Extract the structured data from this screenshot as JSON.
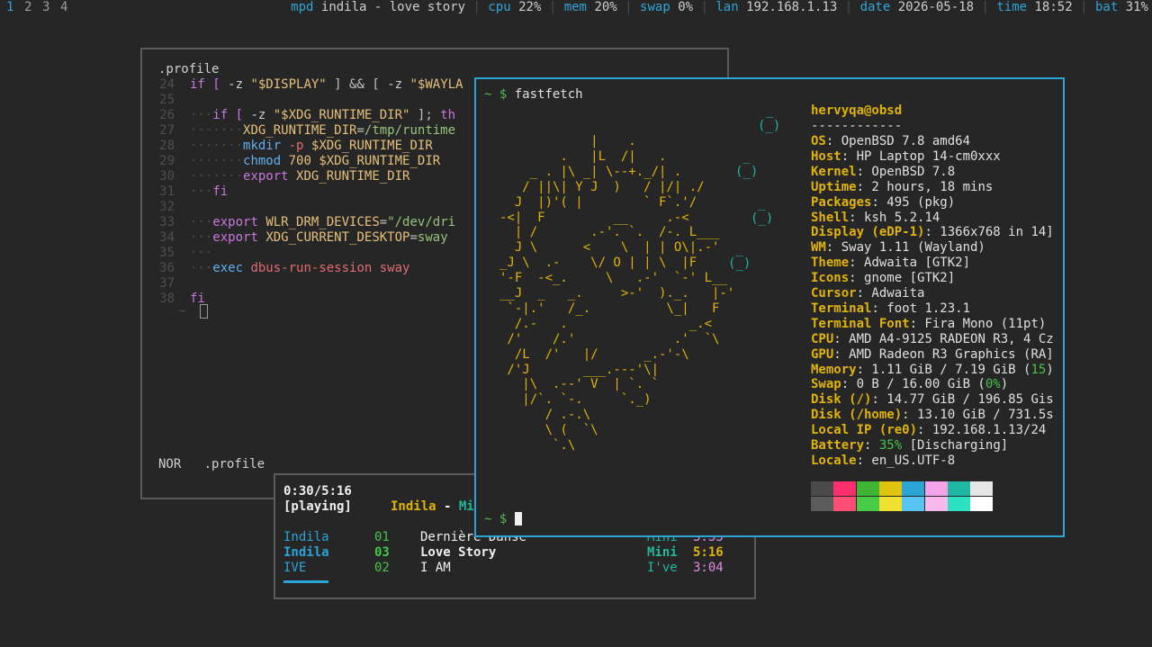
{
  "bar": {
    "workspaces": [
      "1",
      "2",
      "3",
      "4"
    ],
    "mpd_label": "mpd",
    "mpd_value": "indila - love story",
    "cpu_label": "cpu",
    "cpu_value": "22%",
    "mem_label": "mem",
    "mem_value": "20%",
    "swap_label": "swap",
    "swap_value": "0%",
    "lan_label": "lan",
    "lan_value": "192.168.1.13",
    "date_label": "date",
    "date_value": "2026-05-18",
    "time_label": "time",
    "time_value": "18:52",
    "bat_label": "bat",
    "bat_value": "31%",
    "separator": "|"
  },
  "editor": {
    "filename_top": ".profile",
    "mode": "NOR",
    "filename_status": ".profile",
    "tilde": "~",
    "lines": [
      {
        "n": "24",
        "indent": "",
        "tokens": [
          {
            "t": "if [ ",
            "c": "kw"
          },
          {
            "t": "-z ",
            "c": "pl"
          },
          {
            "t": "\"$DISPLAY\"",
            "c": "var"
          },
          {
            "t": " ] && [ ",
            "c": "pun"
          },
          {
            "t": "-z ",
            "c": "pl"
          },
          {
            "t": "\"$WAYLA",
            "c": "var"
          }
        ]
      },
      {
        "n": "25",
        "indent": "",
        "tokens": []
      },
      {
        "n": "26",
        "indent": "···",
        "tokens": [
          {
            "t": "if [ ",
            "c": "kw"
          },
          {
            "t": "-z ",
            "c": "pl"
          },
          {
            "t": "\"$XDG_RUNTIME_DIR\"",
            "c": "var"
          },
          {
            "t": " ]; ",
            "c": "pun"
          },
          {
            "t": "th",
            "c": "kw"
          }
        ]
      },
      {
        "n": "27",
        "indent": "·······",
        "tokens": [
          {
            "t": "XDG_RUNTIME_DIR",
            "c": "var"
          },
          {
            "t": "=",
            "c": "pun"
          },
          {
            "t": "/tmp/runtime",
            "c": "str"
          }
        ]
      },
      {
        "n": "28",
        "indent": "·······",
        "tokens": [
          {
            "t": "mkdir ",
            "c": "cmd"
          },
          {
            "t": "-p ",
            "c": "red"
          },
          {
            "t": "$XDG_RUNTIME_DIR",
            "c": "var"
          }
        ]
      },
      {
        "n": "29",
        "indent": "·······",
        "tokens": [
          {
            "t": "chmod ",
            "c": "cmd"
          },
          {
            "t": "700 ",
            "c": "var"
          },
          {
            "t": "$XDG_RUNTIME_DIR",
            "c": "var"
          }
        ]
      },
      {
        "n": "30",
        "indent": "·······",
        "tokens": [
          {
            "t": "export ",
            "c": "kw"
          },
          {
            "t": "XDG_RUNTIME_DIR",
            "c": "var"
          }
        ]
      },
      {
        "n": "31",
        "indent": "···",
        "tokens": [
          {
            "t": "fi",
            "c": "kw"
          }
        ]
      },
      {
        "n": "32",
        "indent": "",
        "tokens": []
      },
      {
        "n": "33",
        "indent": "···",
        "tokens": [
          {
            "t": "export ",
            "c": "kw"
          },
          {
            "t": "WLR_DRM_DEVICES",
            "c": "var"
          },
          {
            "t": "=",
            "c": "pun"
          },
          {
            "t": "\"/dev/dri",
            "c": "str"
          }
        ]
      },
      {
        "n": "34",
        "indent": "···",
        "tokens": [
          {
            "t": "export ",
            "c": "kw"
          },
          {
            "t": "XDG_CURRENT_DESKTOP",
            "c": "var"
          },
          {
            "t": "=",
            "c": "pun"
          },
          {
            "t": "sway",
            "c": "str"
          }
        ]
      },
      {
        "n": "35",
        "indent": "···",
        "tokens": []
      },
      {
        "n": "36",
        "indent": "···",
        "tokens": [
          {
            "t": "exec ",
            "c": "cmd"
          },
          {
            "t": "dbus-run-session ",
            "c": "red"
          },
          {
            "t": "sway",
            "c": "red"
          }
        ]
      },
      {
        "n": "37",
        "indent": "",
        "tokens": []
      },
      {
        "n": "38",
        "indent": "",
        "tokens": [
          {
            "t": "fi",
            "c": "kw"
          }
        ]
      }
    ]
  },
  "fastfetch": {
    "prompt_symbol": "~ $",
    "command": "fastfetch",
    "user_host": "hervyqa@obsd",
    "rule": "------------",
    "info": [
      {
        "k": "OS",
        "v": ": OpenBSD 7.8 amd64"
      },
      {
        "k": "Host",
        "v": ": HP Laptop 14-cm0xxx"
      },
      {
        "k": "Kernel",
        "v": ": OpenBSD 7.8"
      },
      {
        "k": "Uptime",
        "v": ": 2 hours, 18 mins"
      },
      {
        "k": "Packages",
        "v": ": 495 (pkg)"
      },
      {
        "k": "Shell",
        "v": ": ksh 5.2.14"
      },
      {
        "k": "Display (eDP-1)",
        "v": ": 1366x768 in 14]"
      },
      {
        "k": "WM",
        "v": ": Sway 1.11 (Wayland)"
      },
      {
        "k": "Theme",
        "v": ": Adwaita [GTK2]"
      },
      {
        "k": "Icons",
        "v": ": gnome [GTK2]"
      },
      {
        "k": "Cursor",
        "v": ": Adwaita"
      },
      {
        "k": "Terminal",
        "v": ": foot 1.23.1"
      },
      {
        "k": "Terminal Font",
        "v": ": Fira Mono (11pt)"
      },
      {
        "k": "CPU",
        "v": ": AMD A4-9125 RADEON R3, 4 Cz"
      },
      {
        "k": "GPU",
        "v": ": AMD Radeon R3 Graphics (RA]"
      },
      {
        "k": "Memory",
        "v": ": 1.11 GiB / 7.19 GiB (",
        "g": "15",
        "e": ")"
      },
      {
        "k": "Swap",
        "v": ": 0 B / 16.00 GiB (",
        "g": "0%",
        "e": ")"
      },
      {
        "k": "Disk (/)",
        "v": ": 14.77 GiB / 196.85 Gis"
      },
      {
        "k": "Disk (/home)",
        "v": ": 13.10 GiB / 731.5s"
      },
      {
        "k": "Local IP (re0)",
        "v": ": 192.168.1.13/24"
      },
      {
        "k": "Battery",
        "v": ": ",
        "g": "35%",
        "e": " [Discharging]"
      },
      {
        "k": "Locale",
        "v": ": en_US.UTF-8"
      }
    ],
    "ascii": [
      "            |    .",
      "        .   |L  /|   .",
      "    _ . |\\ _| \\--+._/| .",
      "   / ||\\| Y J  )   / |/| ./",
      "  J  |)'( |        ` F`.'/",
      "-<|  F         __     .-<",
      "  | /       .-'. `.  /-. L___",
      "  J \\      <    \\  | | O\\|.-'",
      "_J \\  .-    \\/ O | | \\  |F",
      "'-F  -<_.     \\   .-'  `-' L__",
      "__J  _   _.     >-'  )._.   |-'",
      " `-|.'   /_.          \\_|   F",
      "  /.-   .                _.<",
      " /'    /.'             .'  `\\",
      "  /L  /'   |/      _.-'-\\",
      " /'J       ___.---'\\|",
      "   |\\  .--' V  | `. `",
      "   |/`. `-.     `._)",
      "      / .-.\\",
      "      \\ (  `\\",
      "       `.\\"
    ],
    "cyan_marks": [
      "_",
      "(_)",
      "_",
      "(_)",
      "_",
      "(_)",
      "_",
      "(_)"
    ],
    "palette_top": [
      "#4a4a4a",
      "#ff2f6d",
      "#3fb633",
      "#e0c30c",
      "#2ba4d6",
      "#f5a3e8",
      "#1fb6a3",
      "#e6e6e6"
    ],
    "palette_bottom": [
      "#5c5c5c",
      "#ff4d77",
      "#48cc48",
      "#f0e030",
      "#57c5f0",
      "#f8b8ee",
      "#2ce0c2",
      "#ffffff"
    ],
    "prompt2": "~ $"
  },
  "mpd": {
    "elapsed": "0:30/5:16",
    "state": "[playing]",
    "now_artist": "Indila",
    "now_dash": " - ",
    "now_title_partial": "Mi",
    "rows": [
      {
        "artist": "Indila",
        "track": "01",
        "title": "Dernière Danse",
        "album": "Mini",
        "time": "3:33",
        "current": false
      },
      {
        "artist": "Indila",
        "track": "03",
        "title": "Love Story",
        "album": "Mini",
        "time": "5:16",
        "current": true
      },
      {
        "artist": "IVE",
        "track": "02",
        "title": "I AM",
        "album": "I've",
        "time": "3:04",
        "current": false
      }
    ]
  }
}
